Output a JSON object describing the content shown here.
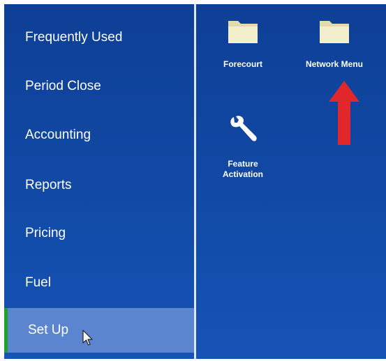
{
  "sidebar": {
    "items": [
      {
        "label": "Frequently Used"
      },
      {
        "label": "Period Close"
      },
      {
        "label": "Accounting"
      },
      {
        "label": "Reports"
      },
      {
        "label": "Pricing"
      },
      {
        "label": "Fuel"
      },
      {
        "label": "Set Up",
        "selected": true
      }
    ]
  },
  "tiles": {
    "forecourt": {
      "label": "Forecourt",
      "icon": "folder-icon"
    },
    "network_menu": {
      "label": "Network Menu",
      "icon": "folder-icon"
    },
    "feature_activation": {
      "label_line1": "Feature",
      "label_line2": "Activation",
      "icon": "wrench-icon"
    }
  },
  "colors": {
    "background": "#114aa6",
    "selected_item": "#5b86cf",
    "selected_marker": "#21a12c",
    "annotation_arrow": "#e0282c",
    "folder": "#f1ecc6"
  }
}
